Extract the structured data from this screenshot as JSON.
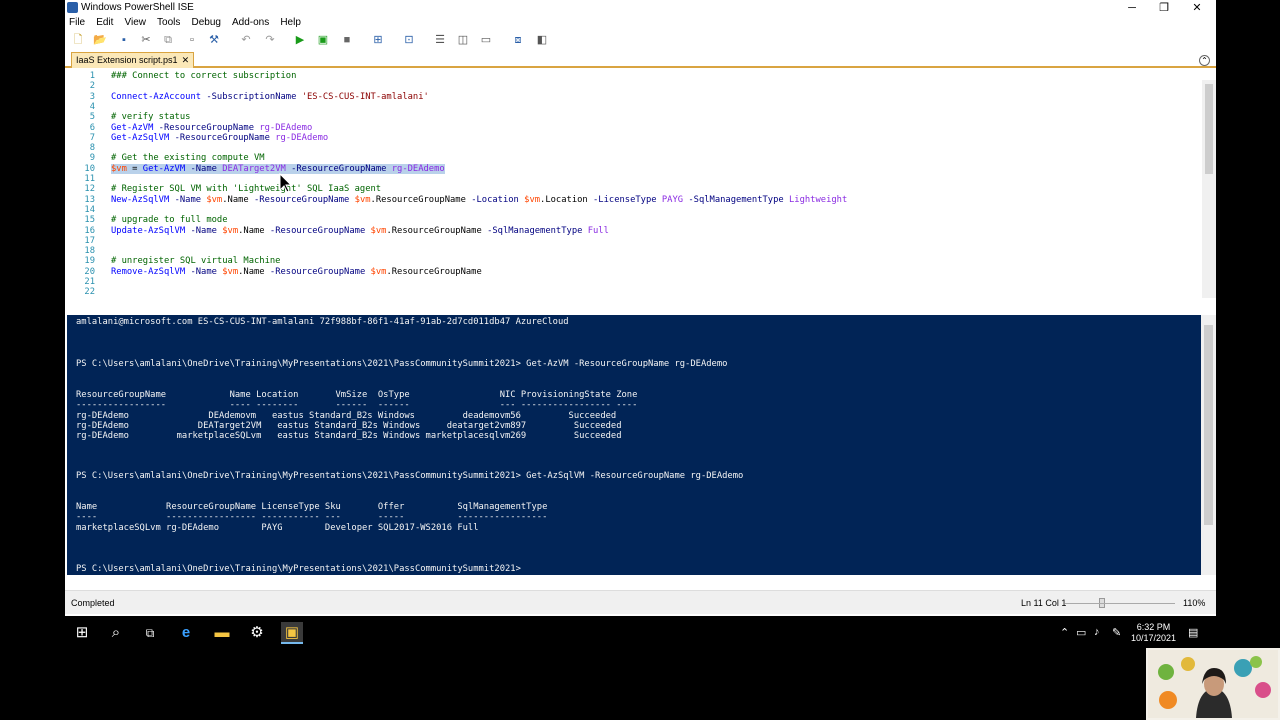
{
  "window": {
    "title": "Windows PowerShell ISE",
    "minimize": "─",
    "restore": "❐",
    "close": "✕"
  },
  "menu": [
    "File",
    "Edit",
    "View",
    "Tools",
    "Debug",
    "Add-ons",
    "Help"
  ],
  "tab": {
    "label": "IaaS Extension script.ps1",
    "close": "✕"
  },
  "editor": {
    "lines": [
      {
        "n": "1",
        "text": "### Connect to correct subscription"
      },
      {
        "n": "2",
        "text": ""
      },
      {
        "n": "3",
        "text": "Connect-AzAccount -SubscriptionName 'ES-CS-CUS-INT-amlalani'"
      },
      {
        "n": "4",
        "text": ""
      },
      {
        "n": "5",
        "text": "# verify status"
      },
      {
        "n": "6",
        "text": "Get-AzVM -ResourceGroupName rg-DEAdemo"
      },
      {
        "n": "7",
        "text": "Get-AzSqlVM -ResourceGroupName rg-DEAdemo"
      },
      {
        "n": "8",
        "text": ""
      },
      {
        "n": "9",
        "text": "# Get the existing compute VM"
      },
      {
        "n": "10",
        "text": "$vm = Get-AzVM -Name DEATarget2VM -ResourceGroupName rg-DEAdemo"
      },
      {
        "n": "11",
        "text": ""
      },
      {
        "n": "12",
        "text": "# Register SQL VM with 'Lightweight' SQL IaaS agent"
      },
      {
        "n": "13",
        "text": "New-AzSqlVM -Name $vm.Name -ResourceGroupName $vm.ResourceGroupName -Location $vm.Location -LicenseType PAYG -SqlManagementType Lightweight"
      },
      {
        "n": "14",
        "text": ""
      },
      {
        "n": "15",
        "text": "# upgrade to full mode"
      },
      {
        "n": "16",
        "text": "Update-AzSqlVM -Name $vm.Name -ResourceGroupName $vm.ResourceGroupName -SqlManagementType Full"
      },
      {
        "n": "17",
        "text": ""
      },
      {
        "n": "18",
        "text": ""
      },
      {
        "n": "19",
        "text": "# unregister SQL virtual Machine"
      },
      {
        "n": "20",
        "text": "Remove-AzSqlVM -Name $vm.Name -ResourceGroupName $vm.ResourceGroupName"
      },
      {
        "n": "21",
        "text": ""
      },
      {
        "n": "22",
        "text": ""
      }
    ]
  },
  "console": {
    "lines": [
      "amlalani@microsoft.com ES-CS-CUS-INT-amlalani 72f988bf-86f1-41af-91ab-2d7cd011db47 AzureCloud",
      "",
      "",
      "",
      "PS C:\\Users\\amlalani\\OneDrive\\Training\\MyPresentations\\2021\\PassCommunitySummit2021> Get-AzVM -ResourceGroupName rg-DEAdemo",
      "",
      "",
      "ResourceGroupName            Name Location       VmSize  OsType                 NIC ProvisioningState Zone",
      "-----------------            ---- --------       ------  ------                 --- ----------------- ----",
      "rg-DEAdemo               DEAdemovm   eastus Standard_B2s Windows         deademovm56         Succeeded",
      "rg-DEAdemo             DEATarget2VM   eastus Standard_B2s Windows     deatarget2vm897         Succeeded",
      "rg-DEAdemo         marketplaceSQLvm   eastus Standard_B2s Windows marketplacesqlvm269         Succeeded",
      "",
      "",
      "",
      "PS C:\\Users\\amlalani\\OneDrive\\Training\\MyPresentations\\2021\\PassCommunitySummit2021> Get-AzSqlVM -ResourceGroupName rg-DEAdemo",
      "",
      "",
      "Name             ResourceGroupName LicenseType Sku       Offer          SqlManagementType",
      "----             ----------------- ----------- ---       -----          -----------------",
      "marketplaceSQLvm rg-DEAdemo        PAYG        Developer SQL2017-WS2016 Full",
      "",
      "",
      "",
      "PS C:\\Users\\amlalani\\OneDrive\\Training\\MyPresentations\\2021\\PassCommunitySummit2021>"
    ]
  },
  "status": {
    "text": "Completed",
    "position": "Ln 11  Col 1",
    "zoom": "110%"
  },
  "taskbar": {
    "time": "6:32 PM",
    "date": "10/17/2021"
  },
  "colors": {
    "console_bg": "#012456",
    "highlight": "#b9d1ea",
    "tab_accent": "#d9a441"
  }
}
